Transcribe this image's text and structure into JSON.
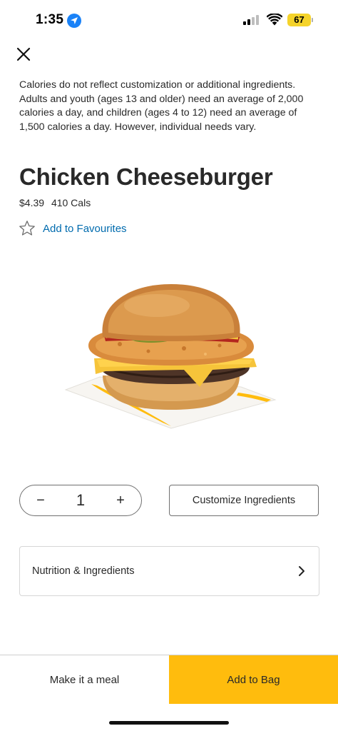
{
  "status_bar": {
    "time": "1:35",
    "battery": "67",
    "location_icon": "location-arrow-icon",
    "signal_icon": "cellular-signal-icon",
    "wifi_icon": "wifi-icon",
    "battery_color": "#f5d32a"
  },
  "header": {
    "close_icon": "close-icon"
  },
  "disclaimer": "Calories do not reflect customization or additional ingredients.  Adults and youth (ages 13 and older) need an average of 2,000 calories a day, and children (ages 4 to 12) need an average of 1,500 calories a day.  However, individual needs vary.",
  "product": {
    "name": "Chicken Cheeseburger",
    "price": "$4.39",
    "calories": "410 Cals",
    "favourite_label": "Add to Favourites",
    "favourite_icon": "star-outline-icon",
    "image": "chicken-cheeseburger-image"
  },
  "quantity": {
    "decrement": "−",
    "value": "1",
    "increment": "+"
  },
  "customize_label": "Customize Ingredients",
  "nutrition": {
    "label": "Nutrition & Ingredients",
    "chevron_icon": "chevron-right-icon"
  },
  "bottom_bar": {
    "meal_label": "Make it a meal",
    "bag_label": "Add to Bag"
  },
  "colors": {
    "accent_yellow": "#ffbc0d",
    "link_blue": "#006bae",
    "text": "#292929"
  }
}
